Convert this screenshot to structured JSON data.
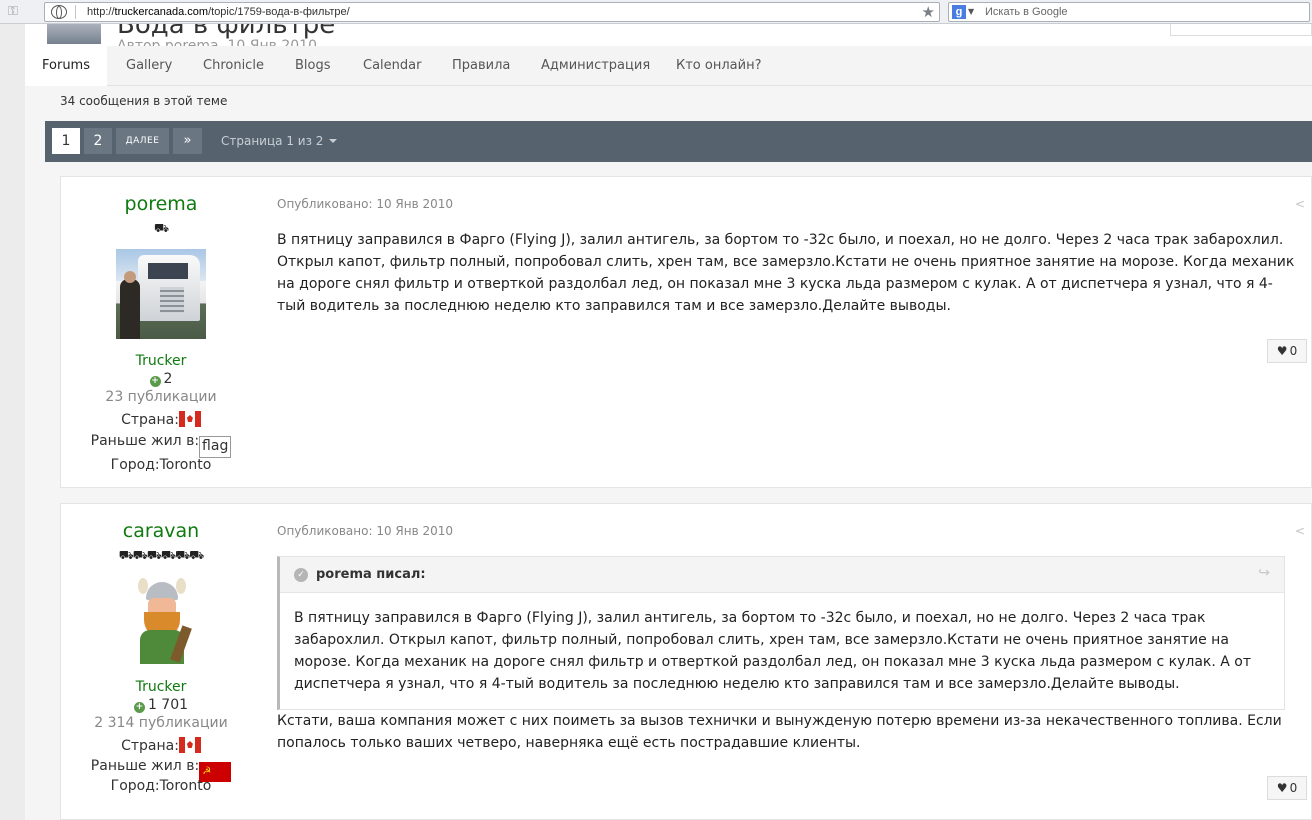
{
  "browser": {
    "url_prefix": "http://",
    "url_host": "truckercanada.com",
    "url_path": "/topic/1759-вода-в-фильтре/",
    "search_placeholder": "Искать в Google"
  },
  "header": {
    "title": "Вода в фильтре",
    "meta": "Автор porema, 10 Янв 2010"
  },
  "nav": {
    "tabs": [
      {
        "label": "Forums",
        "active": true
      },
      {
        "label": "Gallery"
      },
      {
        "label": "Chronicle"
      },
      {
        "label": "Blogs"
      },
      {
        "label": "Calendar"
      },
      {
        "label": "Правила"
      },
      {
        "label": "Администрация"
      },
      {
        "label": "Кто онлайн?"
      }
    ]
  },
  "topic": {
    "count_text": "34 сообщения в этой теме"
  },
  "pagination": {
    "pages": [
      "1",
      "2"
    ],
    "next_label": "ДАЛЕЕ",
    "last_label": "»",
    "info": "Страница 1 из 2"
  },
  "posts": [
    {
      "author": "porema",
      "rank_icons": "⛟",
      "title": "Trucker",
      "reputation": "2",
      "posts_count": "23 публикации",
      "country_label": "Страна:",
      "prev_label": "Раньше жил в:",
      "prev_flag_alt": "flag",
      "city": "Город:Toronto",
      "date": "Опубликовано: 10 Янв 2010",
      "body": "В пятницу заправился в Фарго (Flying J), залил антигель, за бортом то -32с было, и поехал, но не долго. Через 2 часа трак забарохлил. Открыл капот, фильтр полный, попробовал слить, хрен там, все замерзло.Кстати не очень приятное занятие на морозе. Когда механик на дороге снял фильтр и отверткой раздолбал лед, он показал мне 3 куска льда размером с кулак. А от диспетчера я узнал, что я 4-тый водитель за последнюю неделю кто заправился там и все замерзло.Делайте выводы.",
      "likes": "0"
    },
    {
      "author": "caravan",
      "rank_icons": "⛟⛟⛟⛟⛟⛟",
      "title": "Trucker",
      "reputation": "1 701",
      "posts_count": "2 314 публикации",
      "country_label": "Страна:",
      "prev_label": "Раньше жил в:",
      "prev_flag_text": "☭",
      "city": "Город:Toronto",
      "date": "Опубликовано: 10 Янв 2010",
      "quote_author": "porema писал:",
      "quote_body": "В пятницу заправился в Фарго (Flying J), залил антигель, за бортом то -32с было, и поехал, но не долго. Через 2 часа трак забарохлил. Открыл капот, фильтр полный, попробовал слить, хрен там, все замерзло.Кстати не очень приятное занятие на морозе. Когда механик на дороге снял фильтр и отверткой раздолбал лед, он показал мне 3 куска льда размером с кулак. А от диспетчера я узнал, что я 4-тый водитель за последнюю неделю кто заправился там и все замерзло.Делайте выводы.",
      "body": "Кстати, ваша компания может с них поиметь за вызов технички и вынужденую потерю времени из-за некачественного топлива. Если попалось только ваших четверо, наверняка ещё есть пострадавшие клиенты.",
      "likes": "0"
    }
  ]
}
